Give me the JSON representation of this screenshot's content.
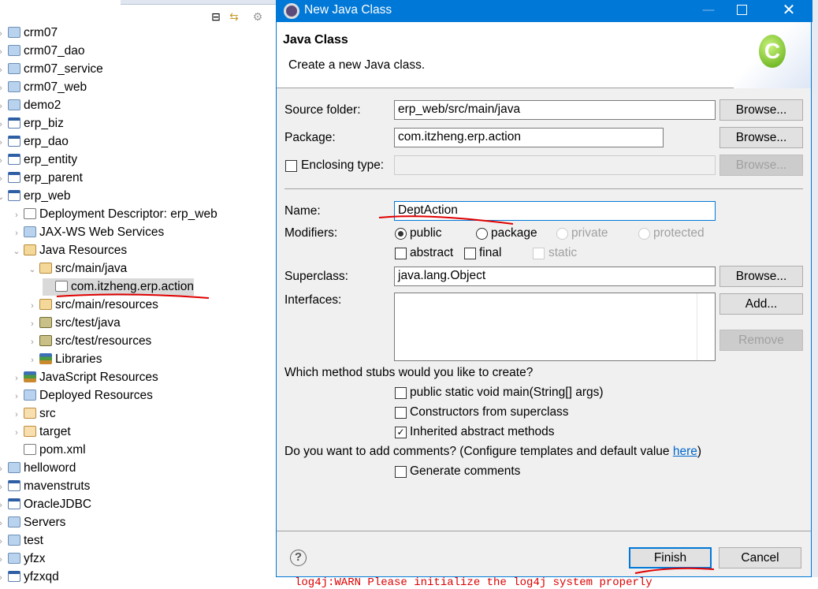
{
  "explorer": {
    "items": [
      {
        "label": "crm07",
        "icon": "folder-project-icon",
        "level": 0,
        "twisty": ">"
      },
      {
        "label": "crm07_dao",
        "icon": "folder-project-icon",
        "level": 0,
        "twisty": ">"
      },
      {
        "label": "crm07_service",
        "icon": "folder-project-icon",
        "level": 0,
        "twisty": ">"
      },
      {
        "label": "crm07_web",
        "icon": "folder-project-icon",
        "level": 0,
        "twisty": ">"
      },
      {
        "label": "demo2",
        "icon": "folder-project-icon",
        "level": 0,
        "twisty": ">"
      },
      {
        "label": "erp_biz",
        "icon": "maven-project-icon",
        "level": 0,
        "twisty": ">"
      },
      {
        "label": "erp_dao",
        "icon": "maven-project-warning-icon",
        "level": 0,
        "twisty": ">"
      },
      {
        "label": "erp_entity",
        "icon": "maven-project-icon",
        "level": 0,
        "twisty": ">"
      },
      {
        "label": "erp_parent",
        "icon": "maven-project-icon",
        "level": 0,
        "twisty": ">"
      },
      {
        "label": "erp_web",
        "icon": "maven-project-icon",
        "level": 0,
        "twisty": "v"
      },
      {
        "label": "Deployment Descriptor: erp_web",
        "icon": "deployment-descriptor-icon",
        "level": 1,
        "twisty": ">"
      },
      {
        "label": "JAX-WS Web Services",
        "icon": "web-services-icon",
        "level": 1,
        "twisty": ">"
      },
      {
        "label": "Java Resources",
        "icon": "java-resources-icon",
        "level": 1,
        "twisty": "v"
      },
      {
        "label": "src/main/java",
        "icon": "source-folder-icon",
        "level": 2,
        "twisty": "v"
      },
      {
        "label": "com.itzheng.erp.action",
        "icon": "package-icon",
        "level": 3,
        "twisty": "",
        "selected": true
      },
      {
        "label": "src/main/resources",
        "icon": "source-folder-icon",
        "level": 2,
        "twisty": ">"
      },
      {
        "label": "src/test/java",
        "icon": "test-source-folder-icon",
        "level": 2,
        "twisty": ">"
      },
      {
        "label": "src/test/resources",
        "icon": "test-source-folder-icon",
        "level": 2,
        "twisty": ">"
      },
      {
        "label": "Libraries",
        "icon": "libraries-icon",
        "level": 2,
        "twisty": ">"
      },
      {
        "label": "JavaScript Resources",
        "icon": "libraries-icon",
        "level": 1,
        "twisty": ">"
      },
      {
        "label": "Deployed Resources",
        "icon": "deployed-resources-icon",
        "level": 1,
        "twisty": ">"
      },
      {
        "label": "src",
        "icon": "folder-icon",
        "level": 1,
        "twisty": ">"
      },
      {
        "label": "target",
        "icon": "folder-icon",
        "level": 1,
        "twisty": ">"
      },
      {
        "label": "pom.xml",
        "icon": "maven-file-icon",
        "level": 1,
        "twisty": ""
      },
      {
        "label": "helloword",
        "icon": "folder-project-icon",
        "level": 0,
        "twisty": ">"
      },
      {
        "label": "mavenstruts",
        "icon": "maven-project-warning-icon",
        "level": 0,
        "twisty": ">"
      },
      {
        "label": "OracleJDBC",
        "icon": "maven-project-warning-icon",
        "level": 0,
        "twisty": ">"
      },
      {
        "label": "Servers",
        "icon": "folder-open-icon",
        "level": 0,
        "twisty": ">"
      },
      {
        "label": "test",
        "icon": "folder-project-icon",
        "level": 0,
        "twisty": ">"
      },
      {
        "label": "yfzx",
        "icon": "folder-project-icon",
        "level": 0,
        "twisty": ">"
      },
      {
        "label": "yfzxqd",
        "icon": "web-project-warning-icon",
        "level": 0,
        "twisty": ">"
      }
    ]
  },
  "dialog": {
    "title": "New Java Class",
    "header_title": "Java Class",
    "header_desc": "Create a new Java class.",
    "source_folder_label": "Source folder:",
    "source_folder_value": "erp_web/src/main/java",
    "package_label": "Package:",
    "package_value": "com.itzheng.erp.action",
    "enclosing_label": "Enclosing type:",
    "enclosing_value": "",
    "browse": "Browse...",
    "name_label": "Name:",
    "name_value": "DeptAction",
    "modifiers_label": "Modifiers:",
    "mod_public": "public",
    "mod_package": "package",
    "mod_private": "private",
    "mod_protected": "protected",
    "mod_abstract": "abstract",
    "mod_final": "final",
    "mod_static": "static",
    "superclass_label": "Superclass:",
    "superclass_value": "java.lang.Object",
    "interfaces_label": "Interfaces:",
    "add": "Add...",
    "remove": "Remove",
    "stubs_question": "Which method stubs would you like to create?",
    "stub_main": "public static void main(String[] args)",
    "stub_ctors": "Constructors from superclass",
    "stub_inherited": "Inherited abstract methods",
    "comments_question": "Do you want to add comments? (Configure templates and default value ",
    "comments_link": "here",
    "comments_close": ")",
    "gen_comments": "Generate comments",
    "finish": "Finish",
    "cancel": "Cancel",
    "state": {
      "modifier": "public",
      "abstract": false,
      "final": false,
      "static": false,
      "stub_main": false,
      "stub_ctors": false,
      "stub_inherited": true,
      "gen_comments": false
    }
  },
  "console": {
    "text": "log4j:WARN Please initialize the log4j system properly"
  },
  "colors": {
    "titlebar": "#0078d7",
    "annotation": "#e00000",
    "link": "#0066cc"
  }
}
